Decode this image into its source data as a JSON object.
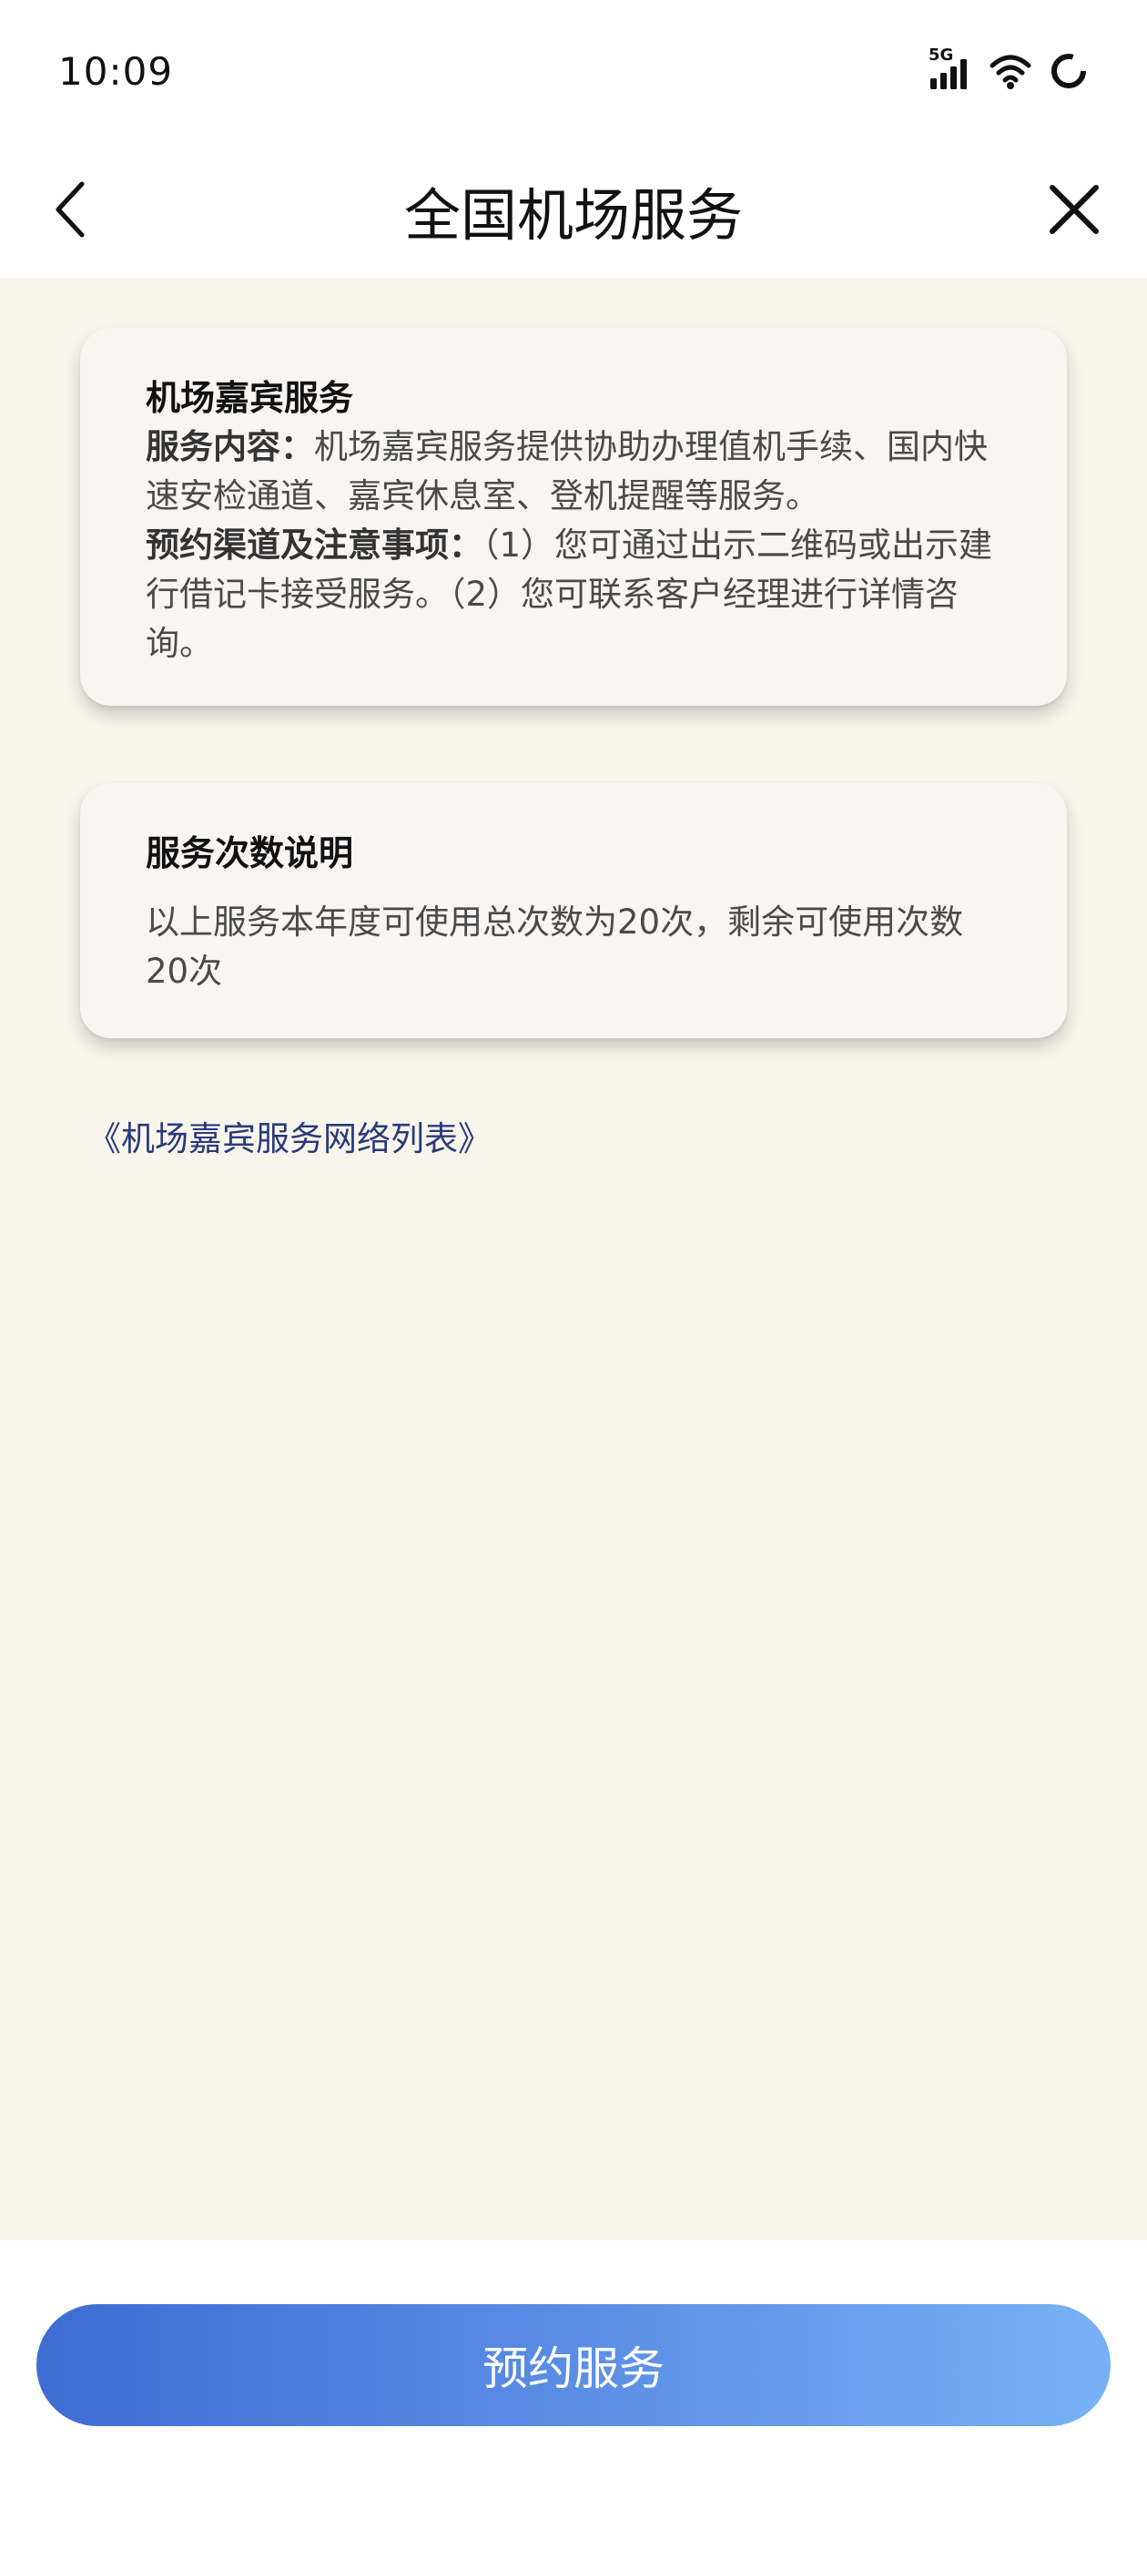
{
  "status_bar": {
    "time": "10:09",
    "network_label": "5G",
    "icons": [
      "signal-5g-icon",
      "wifi-icon",
      "loading-ring-icon"
    ]
  },
  "nav": {
    "title": "全国机场服务",
    "back_icon": "chevron-left-icon",
    "close_icon": "close-icon"
  },
  "cards": {
    "service": {
      "title": "机场嘉宾服务",
      "content_label": "服务内容：",
      "content_text": "机场嘉宾服务提供协助办理值机手续、国内快速安检通道、嘉宾休息室、登机提醒等服务。",
      "channel_label": "预约渠道及注意事项：",
      "channel_text": "（1）您可通过出示二维码或出示建行借记卡接受服务。（2）您可联系客户经理进行详情咨询。"
    },
    "count": {
      "title": "服务次数说明",
      "text": "以上服务本年度可使用总次数为20次，剩余可使用次数20次"
    }
  },
  "link": {
    "text": "《机场嘉宾服务网络列表》"
  },
  "footer": {
    "book_button_label": "预约服务"
  },
  "colors": {
    "content_background": "#f8f6ec",
    "card_background": "#f8f5f3",
    "link": "#2a3a7a",
    "button_gradient_start": "#3d6dd3",
    "button_gradient_end": "#78b1f5"
  }
}
